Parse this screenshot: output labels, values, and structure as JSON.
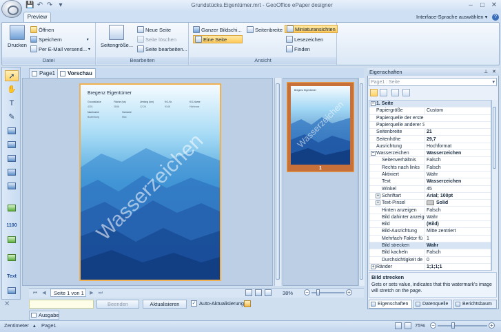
{
  "window": {
    "title": "Grundstücks.Eigentümer.mrt - GeoOffice ePaper designer",
    "minimize": "–",
    "maximize": "□",
    "close": "✕"
  },
  "qat": {
    "save": "💾",
    "undo": "↶",
    "redo": "↷",
    "more": "▾"
  },
  "ribbon": {
    "tab": "Preview",
    "language_menu": "Interface-Sprache auswählen ▾",
    "help": "?",
    "groups": {
      "datei": {
        "label": "Datei",
        "print": "Drucken",
        "open": "Öffnen",
        "save": "Speichern",
        "email": "Per E-Mail versend..."
      },
      "bearbeiten": {
        "label": "Bearbeiten",
        "page_size": "Seitengröße...",
        "new_page": "Neue Seite",
        "delete_page": "Seite löschen",
        "edit_page": "Seite bearbeiten..."
      },
      "ansicht": {
        "label": "Ansicht",
        "whole_screen": "Ganzer Bildschi...",
        "page_width": "Seitenbreite",
        "thumbnails": "Miniaturansichten",
        "one_page": "Eine Seite",
        "bookmarks": "Lesezeichen",
        "find": "Finden"
      }
    }
  },
  "doc_tabs": [
    "Page1",
    "Vorschau"
  ],
  "preview": {
    "heading": "Bregenz Eigentümer",
    "columns": [
      "Grundstücke",
      "Fläche (ha)",
      "Umfang (km)",
      "KG-Nr.",
      "KG-Name"
    ],
    "row1": [
      "4201",
      "2846",
      "12.26",
      "9145",
      "Hörbranz"
    ],
    "columns2": [
      "Nachname",
      "Vorname"
    ],
    "row2": [
      "Bodenburg",
      "Max"
    ],
    "watermark": "Wasserzeichen",
    "thumb_heading": "Bregenz Eigentümer",
    "thumb_number": "1"
  },
  "navigator": {
    "page_indicator": "Seite 1 von 1",
    "zoom": "38%",
    "first": "⏮",
    "prev": "◀",
    "next": "▶",
    "last": "⏭"
  },
  "actions": {
    "stop": "Beenden",
    "refresh": "Aktualisieren",
    "auto_refresh": "Auto-Aktualisierung",
    "output_tab": "Ausgabe"
  },
  "properties": {
    "title": "Eigenschaften",
    "pin": "⊥",
    "close": "✕",
    "combo": "Page1 : Seite",
    "rows": [
      {
        "kind": "cat",
        "name": "1. Seite",
        "value": ""
      },
      {
        "name": "Papiergröße",
        "value": "Custom"
      },
      {
        "name": "Papierquelle der erste",
        "value": ""
      },
      {
        "name": "Papierquelle anderer S",
        "value": ""
      },
      {
        "name": "Seitenbreite",
        "value": "21",
        "bold": true
      },
      {
        "name": "Seitenhöhe",
        "value": "29,7",
        "bold": true
      },
      {
        "name": "Ausrichtung",
        "value": "Hochformat"
      },
      {
        "kind": "group",
        "name": "Wasserzeichen",
        "value": "Wasserzeichen",
        "bold": true
      },
      {
        "indent": true,
        "name": "Seitenverhältnis",
        "value": "Falsch"
      },
      {
        "indent": true,
        "name": "Rechts nach links",
        "value": "Falsch"
      },
      {
        "indent": true,
        "name": "Aktiviert",
        "value": "Wahr"
      },
      {
        "indent": true,
        "name": "Text",
        "value": "Wasserzeichen",
        "bold": true
      },
      {
        "indent": true,
        "name": "Winkel",
        "value": "45"
      },
      {
        "indent": true,
        "plus": true,
        "name": "Schriftart",
        "value": "Arial; 100pt",
        "bold": true
      },
      {
        "indent": true,
        "plus": true,
        "name": "Text-Pinsel",
        "value": "Solid",
        "bold": true,
        "swatch": true
      },
      {
        "indent": true,
        "name": "Hinten anzeigen",
        "value": "Falsch"
      },
      {
        "indent": true,
        "name": "Bild dahinter anzeige",
        "value": "Wahr"
      },
      {
        "indent": true,
        "name": "Bild",
        "value": "(Bild)",
        "bold": true
      },
      {
        "indent": true,
        "name": "Bild-Ausrichtung",
        "value": "Mitte zentriert"
      },
      {
        "indent": true,
        "name": "Mehrfach-Faktor fü",
        "value": "1"
      },
      {
        "indent": true,
        "name": "Bild strecken",
        "value": "Wahr",
        "bold": true,
        "selected": true
      },
      {
        "indent": true,
        "name": "Bild kacheln",
        "value": "Falsch"
      },
      {
        "indent": true,
        "name": "Durchsichtigkeit de",
        "value": "0"
      },
      {
        "plus": true,
        "name": "Ränder",
        "value": "1;1;1;1",
        "bold": true
      }
    ],
    "desc_title": "Bild strecken",
    "desc_text": "Gets or sets value, indicates that this watermark's image will stretch on the page.",
    "tabs": [
      "Eigenschaften",
      "Datenquelle",
      "Berichtsbaum"
    ]
  },
  "statusbar": {
    "units": "Zentimeter",
    "units_arrow": "▴",
    "page": "Page1",
    "zoom": "75%"
  },
  "colors": {
    "accent": "#ffc95a",
    "ribbon_border": "#9ab3d1",
    "page_border": "#f1b150"
  }
}
